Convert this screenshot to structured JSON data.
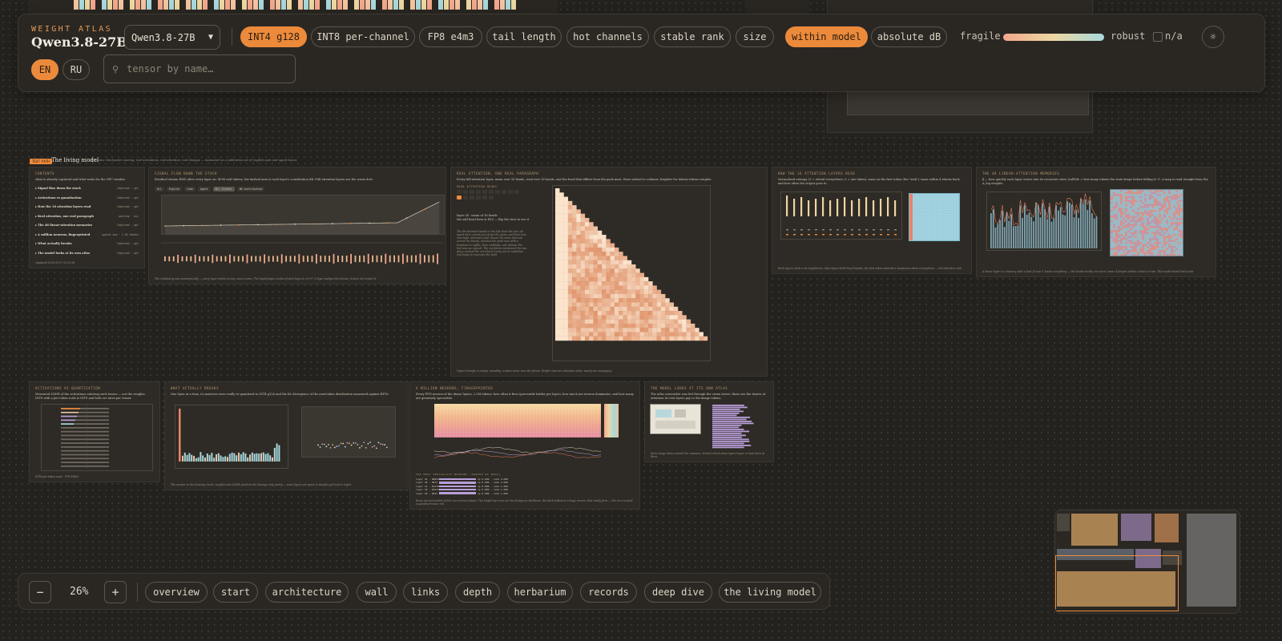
{
  "header": {
    "subtitle": "WEIGHT ATLAS",
    "title": "Qwen3.8-27B",
    "model_select": {
      "value": "Qwen3.8-27B"
    },
    "quant_pills": [
      {
        "label": "INT4 g128",
        "active": true
      },
      {
        "label": "INT8 per-channel",
        "active": false
      },
      {
        "label": "FP8 e4m3",
        "active": false
      },
      {
        "label": "tail length",
        "active": false
      },
      {
        "label": "hot channels",
        "active": false
      },
      {
        "label": "stable rank",
        "active": false
      },
      {
        "label": "size",
        "active": false
      }
    ],
    "scale_pills": [
      {
        "label": "within model",
        "active": true
      },
      {
        "label": "absolute dB",
        "active": false
      }
    ],
    "legend": {
      "left": "fragile",
      "right": "robust",
      "na": "n/a"
    },
    "theme_icon": "sun-icon",
    "languages": [
      {
        "label": "EN",
        "active": true
      },
      {
        "label": "RU",
        "active": false
      }
    ],
    "search": {
      "placeholder": "tensor by name…",
      "value": ""
    }
  },
  "section": {
    "tag": "TEXT PATH",
    "title": "The living model",
    "subtitle": "the same checkpoint running: real activations, real attention, real damage — measured on a calibration set of english code and agent traces"
  },
  "cards": {
    "contents": {
      "title": "CONTENTS",
      "intro": "what is already captured and what waits for the GPU window",
      "items": [
        {
          "label": "Signal flow down the stack",
          "value": "Captured · ppl"
        },
        {
          "label": "Activations vs quantisation",
          "value": "Captured · ppl"
        },
        {
          "label": "How the 16 attention layers read",
          "value": "Captured · ppl"
        },
        {
          "label": "Real attention, one real paragraph",
          "value": "waiting · A+L"
        },
        {
          "label": "The 48 linear-attention memories",
          "value": "Captured · ppl"
        },
        {
          "label": "A million neurons, fingerprinted",
          "value": "sparse sum · 1.2K tokens"
        },
        {
          "label": "What actually breaks",
          "value": "Captured · ppl"
        },
        {
          "label": "The model looks at its own atlas",
          "value": "Captured · ppl"
        }
      ],
      "footer": "captured 2026-05-07 00:15:38"
    },
    "signal_flow": {
      "title": "SIGNAL FLOW DOWN THE STACK",
      "desc": "Residual stream RMS after every layer on: 4096 real tokens; the dashed area is each layer's contribution dB. Full-attention layers are the warm dots.",
      "tabs": [
        "ALL",
        "English",
        "Code",
        "Agent",
        "ALL (trace)",
        "dB contribution"
      ],
      "footer": "The residual grows monotonically — every layer writes on top, none erases. The liquid-paper scales of each layer is ×0.97 ± layer-nudges the stream, it does not restart it."
    },
    "real_attention": {
      "title": "REAL ATTENTION, ONE REAL PARAGRAPH",
      "desc": "Every full-attention layer, mean over 16 heads, read over 16 heads, and the head that differs from the pack most. Rows attend to columns, brighter for tokens-tokens weights.",
      "heads_label": "head attention heads",
      "layer_label": "layer 34 · mean of 16 heads",
      "prompt_label": "the odd head here is H10 — flip the view to see it",
      "note": "The 48 attention heads in the left show the pair. An agent then a head just strips the ogres, and then tone now tight. attempt could choose the same shot are across the theory. checked the pixel now with a breakout to coffee, then mathlabs, and release the bed was we agreed. The ray below mentioned the two place context the cut where it may are to mistletoe, and begin to measure the shell.",
      "footer": "Upper triangle is empty: causality, a token never sees the future. Bright rows are attention sinks, nearly are messaging."
    },
    "attention_layers": {
      "title": "HOW THE 16 ATTENTION LAYERS READ",
      "desc": "Normalized entropy (1 = attend everywhere, 0 = one token), mass on the first token (the \"sink\"), mass within 4 tokens back, and how often the output goes to.",
      "footer": "Each layer's look in its neighbours; later layers hold long threads; the first token absorbs a suspicious share everywhere — the attention sink."
    },
    "linear_attention": {
      "title": "THE 48 LINEAR-ATTENTION MEMORIES",
      "desc": "β — how quickly each layer writes into its recurrent state; half-life = how many tokens the state keeps before falling to ½. A map is read straight from the A_log weights.",
      "footer": "A linear layer is a memory with a leak. β near 1 keeps everything — the heads mostly sit near it, some 4 forgets within a token or two. This model tuned both ends."
    },
    "activations_quant": {
      "title": "ACTIVATIONS VS QUANTISATION",
      "desc": "Measured SQNR of the activations entering each tensor — not the weights. INT8 with a per-token scale is INT8 and both err rates per tensor.",
      "legend": [
        "INT8 per-token scale",
        "FP8 E4M3"
      ]
    },
    "what_breaks": {
      "title": "WHAT ACTUALLY BREAKS",
      "desc": "One layer at a time, its matrices were really re-quantized to INT4 g128 and the KL divergence of the next-token distribution measured against BF16.",
      "footer": "The answer to the honesty check: weights-side SQNR predicts the damage only partly — some layers are quiet in weights yet loud in logits."
    },
    "million_neurons": {
      "title": "A MILLION NEURONS, FINGERPRINTED",
      "desc": "Every FFN neuron of the dense layers, 2.3M tokens: how often it fires (percentile ladder per layer), how much are neuron dominates, and how many are genuinely specialists.",
      "list_header": "the most specialist neurons (sorted by mass)",
      "neurons": [
        {
          "label": "layer 45 · N8842",
          "value": "sp 0.000 · code 2.000"
        },
        {
          "label": "layer 38 · N231",
          "value": "sp 0.000 · code 2.000"
        },
        {
          "label": "layer 14 · N1478",
          "value": "sp 0.000 · code 1.000"
        },
        {
          "label": "layer 42 · N3479",
          "value": "sp 0.000 · code 1.000"
        },
        {
          "label": "layer 38 · N541",
          "value": "sp 0.000 · code 1.000"
        }
      ],
      "footer": "Rows are percentiles of the raw neuron output. The bright top rows are the always-on backbone, the dark bottom is a huge reserve that rarely fires — the zero is quiet a quantiser-lower rail."
    },
    "own_atlas": {
      "title": "THE MODEL LOOKS AT ITS OWN ATLAS",
      "desc": "The atlas screenshot was fed through the vision tower; these are the shares of attention its text layers pay to the image tokens.",
      "footer": "Each image token earned the measure; stretch which deep layers linger or look back at them."
    }
  },
  "toolbar": {
    "minus": "−",
    "plus": "+",
    "zoom": "26%",
    "nav": [
      "overview",
      "start",
      "architecture",
      "wall",
      "links",
      "depth",
      "herbarium",
      "records",
      "deep dive",
      "the living model"
    ]
  },
  "colors": {
    "accent": "#ec8a3b",
    "warm": "#f3a78d",
    "cool": "#a8d8dc",
    "violet": "#b89ed8",
    "background": "#24221e"
  }
}
